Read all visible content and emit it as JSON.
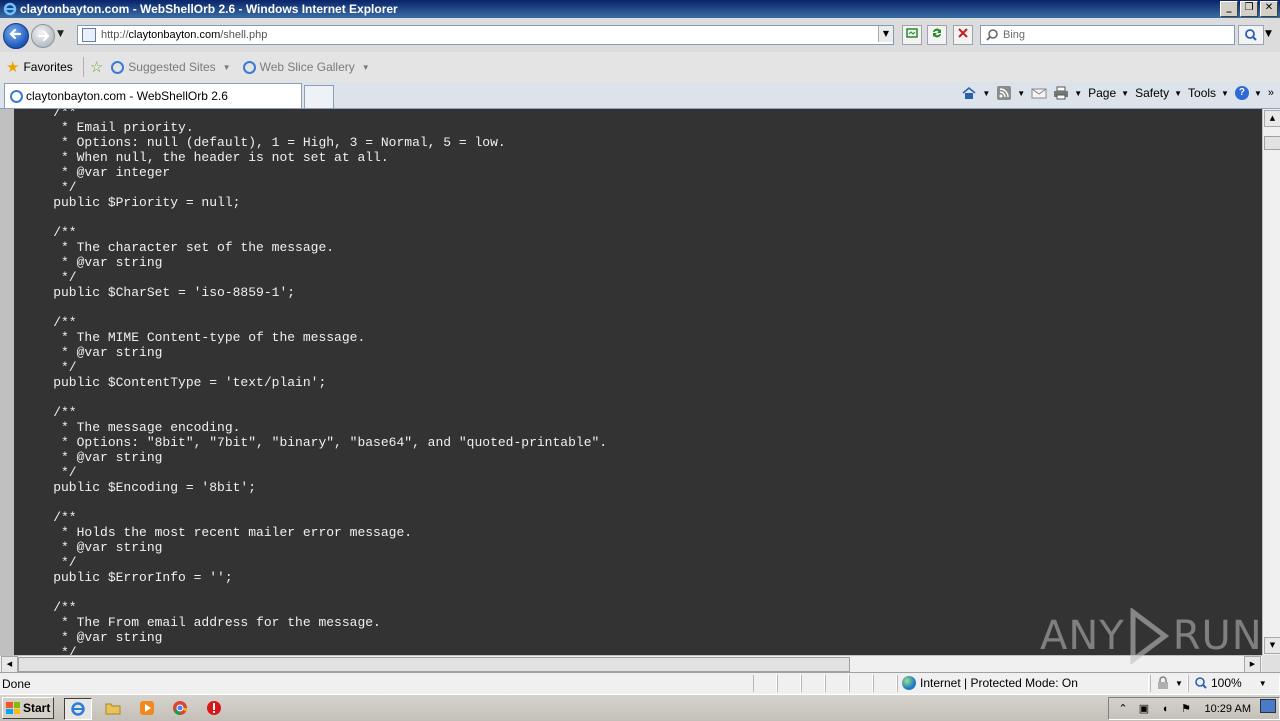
{
  "window": {
    "title": "claytonbayton.com - WebShellOrb 2.6 - Windows Internet Explorer",
    "minimize": "_",
    "restore": "❐",
    "close": "✕"
  },
  "address": {
    "url_prefix": "http://",
    "url_host": "claytonbayton.com",
    "url_path": "/shell.php",
    "search_placeholder": "Bing"
  },
  "favorites_bar": {
    "favorites_label": "Favorites",
    "suggested_sites_label": "Suggested Sites",
    "web_slice_gallery_label": "Web Slice Gallery"
  },
  "tabs": [
    {
      "label": "claytonbayton.com - WebShellOrb 2.6"
    }
  ],
  "command_bar": {
    "page_label": "Page",
    "safety_label": "Safety",
    "tools_label": "Tools"
  },
  "page": {
    "code": "    /**\n     * Email priority.\n     * Options: null (default), 1 = High, 3 = Normal, 5 = low.\n     * When null, the header is not set at all.\n     * @var integer\n     */\n    public $Priority = null;\n\n    /**\n     * The character set of the message.\n     * @var string\n     */\n    public $CharSet = 'iso-8859-1';\n\n    /**\n     * The MIME Content-type of the message.\n     * @var string\n     */\n    public $ContentType = 'text/plain';\n\n    /**\n     * The message encoding.\n     * Options: \"8bit\", \"7bit\", \"binary\", \"base64\", and \"quoted-printable\".\n     * @var string\n     */\n    public $Encoding = '8bit';\n\n    /**\n     * Holds the most recent mailer error message.\n     * @var string\n     */\n    public $ErrorInfo = '';\n\n    /**\n     * The From email address for the message.\n     * @var string\n     */"
  },
  "watermark": {
    "left": "ANY",
    "right": "RUN"
  },
  "status_bar": {
    "status": "Done",
    "zone": "Internet | Protected Mode: On",
    "zoom": "100%"
  },
  "taskbar": {
    "start_label": "Start",
    "clock": "10:29 AM"
  },
  "colors": {
    "code_background": "#333333",
    "code_text": "#f0f0f0",
    "title_bar": "#0a246a"
  }
}
